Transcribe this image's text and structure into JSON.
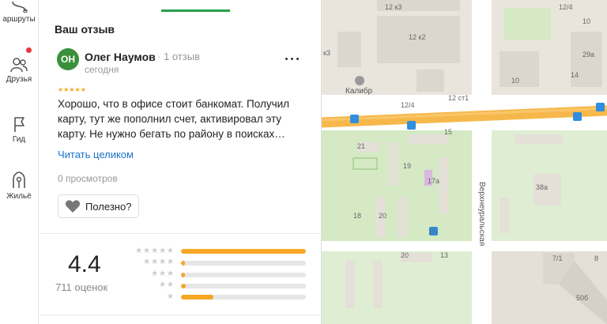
{
  "rail": {
    "items": [
      {
        "label": "аршруты",
        "icon": "route-icon"
      },
      {
        "label": "Друзья",
        "icon": "friends-icon"
      },
      {
        "label": "Гид",
        "icon": "flag-icon"
      },
      {
        "label": "Жильё",
        "icon": "house-icon"
      }
    ]
  },
  "review": {
    "section_title": "Ваш отзыв",
    "avatar_initials": "ОН",
    "author": "Олег Наумов",
    "separator": "·",
    "author_reviews": "1 отзыв",
    "date": "сегодня",
    "stars": "★★★★★",
    "text": "Хорошо, что в офисе стоит банкомат. Получил карту, тут же пополнил счет, активировал эту карту. Не нужно бегать по району в поисках…",
    "read_more": "Читать целиком",
    "views": "0 просмотров",
    "helpful_label": "Полезно?"
  },
  "rating": {
    "value": "4.4",
    "count_label": "711 оценок",
    "distribution": [
      {
        "stars": "★★★★★",
        "fraction": 1.0
      },
      {
        "stars": "★★★★",
        "fraction": 0.03
      },
      {
        "stars": "★★★",
        "fraction": 0.03
      },
      {
        "stars": "★★",
        "fraction": 0.04
      },
      {
        "stars": "★",
        "fraction": 0.26
      }
    ]
  },
  "map": {
    "colors": {
      "bg": "#f2efe9",
      "block": "#e4e0d8",
      "building": "#dcd7ce",
      "park": "#d4e9c4",
      "road": "#ffffff",
      "highway": "#f7b84b",
      "transit": "#2f8ee0"
    },
    "labels": [
      "12 к3",
      "12 к2",
      "к3",
      "10",
      "12 ст1",
      "Калибр",
      "12/4",
      "21",
      "15",
      "19",
      "17а",
      "Верхнеуральская",
      "38а",
      "20",
      "18",
      "20",
      "15",
      "13",
      "7/1",
      "50б",
      "29а",
      "14",
      "12/4",
      "10",
      "8"
    ]
  }
}
